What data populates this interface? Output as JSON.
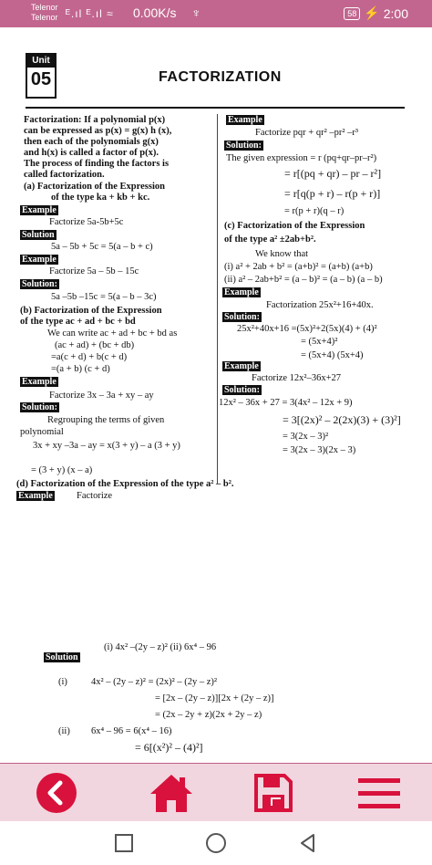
{
  "status_bar": {
    "carrier_1": "Telenor",
    "carrier_2": "Telenor",
    "signal": "ᴱ.ıl ᴱ.ıl ≈",
    "net_speed": "0.00K/s",
    "usb_symbol": "♆",
    "battery": "58",
    "charging": "⚡",
    "time": "2:00"
  },
  "page": {
    "unit_label": "Unit",
    "unit_number": "05",
    "chapter_title": "FACTORIZATION",
    "left": {
      "def_1": "Factorization: If a polynomial p(x)",
      "def_2": "can be expressed as p(x) = g(x) h (x),",
      "def_3": "then each of the polynomials g(x)",
      "def_4": "and h(x) is called a factor of p(x).",
      "def_5": "The process of finding the factors is",
      "def_6": "called factorization.",
      "a_1": "(a)    Factorization of the Expression",
      "a_2": "of the type ka + kb + kc.",
      "example_label_1": "Example",
      "ex1_problem": "Factorize 5a-5b+5c",
      "solution_label_1": "Solution",
      "ex1_solution": "5a – 5b + 5c = 5(a – b + c)",
      "example_label_2": "Example",
      "ex2_problem": "Factorize 5a – 5b – 15c",
      "solution_label_2": "Solution:",
      "ex2_solution": "5a –5b –15c = 5(a – b – 3c)",
      "b_1": "(b)    Factorization of the Expression",
      "b_2": "of the type ac + ad + bc + bd",
      "b_3": "We can write ac + ad + bc + bd as",
      "b_4": "(ac + ad) + (bc + db)",
      "b_5": "=a(c + d) + b(c + d)",
      "b_6": "=(a + b) (c + d)",
      "example_label_3": "Example",
      "ex3_problem": "Factorize 3x – 3a + xy – ay",
      "solution_label_3": "Solution:",
      "ex3_s1": "Regrouping the terms of given",
      "ex3_s2": "polynomial",
      "ex3_s3": "3x + xy –3a – ay = x(3 + y) – a (3 + y)",
      "ex3_s4": "= (3 + y) (x – a)"
    },
    "right": {
      "example_label": "Example",
      "ex_problem": "Factorize pqr + qr² –pr² –r³",
      "solution_label": "Solution:",
      "s1": "The given expression = r (pq+qr–pr–r²)",
      "s2": "= r[(pq + qr) – pr – r²]",
      "s3": "= r[q(p + r) – r(p + r)]",
      "s4": "= r(p + r)(q – r)",
      "c_1": "(c)    Factorization of the Expression",
      "c_2": "of the type a² ±2ab+b².",
      "c_3": "We know that",
      "c_4": "(i)  a² + 2ab + b² = (a+b)² = (a+b) (a+b)",
      "c_5": "(ii) a² – 2ab+b² = (a – b)² = (a – b) (a – b)",
      "example_label_2": "Example",
      "ex2_problem": "Factorization 25x²+16+40x.",
      "solution_label_2": "Solution:",
      "ex2_s1": "25x²+40x+16  =(5x)²+2(5x)(4) + (4)²",
      "ex2_s2": "= (5x+4)²",
      "ex2_s3": "= (5x+4) (5x+4)",
      "example_label_3": "Example",
      "ex3_problem": "Factorize 12x²–36x+27",
      "solution_label_3": "Solution:",
      "ex3_s1": "12x² – 36x + 27 = 3(4x² – 12x + 9)",
      "ex3_s2": "= 3[(2x)² – 2(2x)(3) + (3)²]",
      "ex3_s3": "= 3(2x – 3)²",
      "ex3_s4": "= 3(2x – 3)(2x – 3)"
    },
    "d_line": "(d)      Factorization of the Expression of the type a² – b².",
    "d_example_label": "Example",
    "d_factorize": "Factorize",
    "d_problem": "(i) 4x² –(2y – z)²   (ii)  6x⁴ – 96",
    "d_solution_label": "Solution",
    "d_i": "(i)",
    "d_i_s1": "4x² – (2y – z)² = (2x)² – (2y – z)²",
    "d_i_s2": "= [2x – (2y – z)][2x + (2y – z)]",
    "d_i_s3": "= (2x – 2y + z)(2x + 2y – z)",
    "d_ii": "(ii)",
    "d_ii_s1": "6x⁴ – 96   = 6(x⁴ – 16)",
    "d_ii_s2": "= 6[(x²)² – (4)²]"
  },
  "bottom_nav": {
    "back_icon": "back-arrow-icon",
    "home_icon": "home-icon",
    "save_icon": "save-icon",
    "menu_icon": "hamburger-menu-icon",
    "accent_color": "#d8123c"
  },
  "system_nav": {
    "recents": "square-icon",
    "home": "circle-icon",
    "back": "triangle-icon"
  }
}
